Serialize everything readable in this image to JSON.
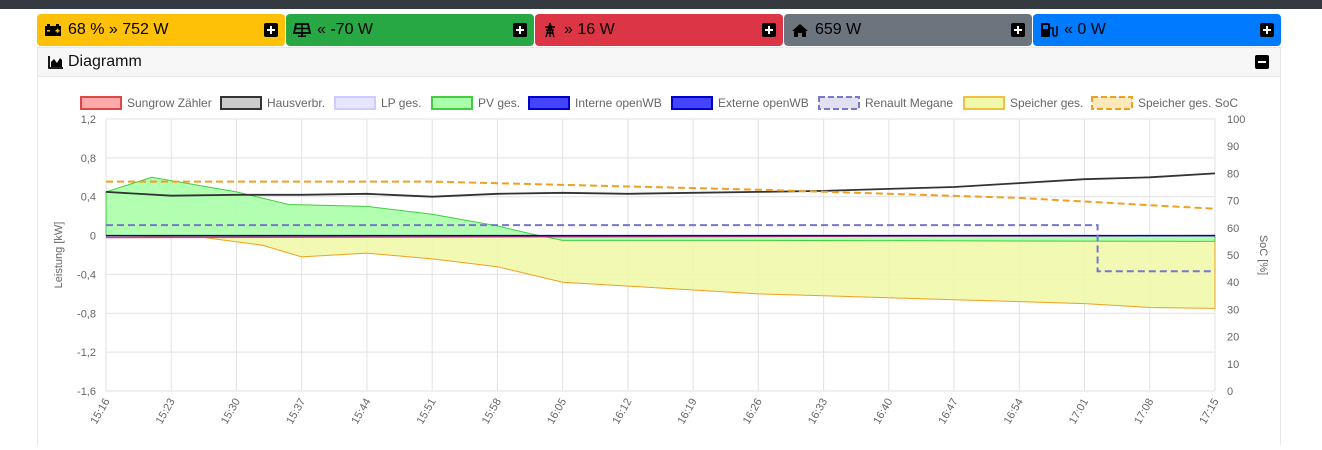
{
  "tiles": [
    {
      "id": "battery",
      "icon": "battery-icon",
      "arrow": "»",
      "text": "68 % » 752 W",
      "bg": "#ffc107",
      "fg": "#000000"
    },
    {
      "id": "pv",
      "icon": "solar-panel-icon",
      "arrow": "«",
      "text": "« -70 W",
      "bg": "#28a745",
      "fg": "#000000"
    },
    {
      "id": "grid",
      "icon": "power-tower-icon",
      "arrow": "»",
      "text": "» 16 W",
      "bg": "#dc3545",
      "fg": "#000000"
    },
    {
      "id": "house",
      "icon": "home-icon",
      "arrow": "",
      "text": "659 W",
      "bg": "#6c757d",
      "fg": "#000000"
    },
    {
      "id": "charge",
      "icon": "charging-station-icon",
      "arrow": "«",
      "text": "« 0 W",
      "bg": "#007bff",
      "fg": "#000000"
    }
  ],
  "card": {
    "title": "Diagramm"
  },
  "chart_data": {
    "type": "line",
    "x": [
      "15:16",
      "15:23",
      "15:30",
      "15:37",
      "15:44",
      "15:51",
      "15:58",
      "16:05",
      "16:12",
      "16:19",
      "16:26",
      "16:33",
      "16:40",
      "16:47",
      "16:54",
      "17:01",
      "17:08",
      "17:15"
    ],
    "ylabel": "Leistung [kW]",
    "y2label": "SoC [%]",
    "ylim": [
      -1.6,
      1.2
    ],
    "y2lim": [
      0,
      100
    ],
    "yticks": [
      "1,2",
      "0,8",
      "0,4",
      "0",
      "-0,4",
      "-0,8",
      "-1,2",
      "-1,6"
    ],
    "y2ticks": [
      "100",
      "90",
      "80",
      "70",
      "60",
      "50",
      "40",
      "30",
      "20",
      "10",
      "0"
    ],
    "grid": true,
    "legend_position": "top",
    "legend": [
      {
        "name": "Sungrow Zähler",
        "fill": "#ffaaaa",
        "stroke": "#e04848",
        "dashed": false
      },
      {
        "name": "Hausverbr.",
        "fill": "#cccccc",
        "stroke": "#333333",
        "dashed": false
      },
      {
        "name": "LP ges.",
        "fill": "#e6e6ff",
        "stroke": "#ccccff",
        "dashed": false
      },
      {
        "name": "PV ges.",
        "fill": "#aaffaa",
        "stroke": "#44cc44",
        "dashed": false
      },
      {
        "name": "Interne openWB",
        "fill": "#4444ff",
        "stroke": "#0000cc",
        "dashed": false
      },
      {
        "name": "Externe openWB",
        "fill": "#4444ff",
        "stroke": "#0000cc",
        "dashed": false
      },
      {
        "name": "Renault Megane",
        "fill": "#e0e0f0",
        "stroke": "#7777cc",
        "dashed": true
      },
      {
        "name": "Speicher ges.",
        "fill": "#f0f8aa",
        "stroke": "#f0c040",
        "dashed": false
      },
      {
        "name": "Speicher ges. SoC",
        "fill": "#fde8bb",
        "stroke": "#f0a020",
        "dashed": true
      }
    ],
    "series": [
      {
        "name": "Hausverbr.",
        "color": "#333333",
        "points": [
          [
            0,
            0.45
          ],
          [
            1,
            0.41
          ],
          [
            2,
            0.42
          ],
          [
            3,
            0.42
          ],
          [
            4,
            0.43
          ],
          [
            5,
            0.4
          ],
          [
            6,
            0.43
          ],
          [
            7,
            0.44
          ],
          [
            8,
            0.43
          ],
          [
            9,
            0.44
          ],
          [
            10,
            0.45
          ],
          [
            11,
            0.46
          ],
          [
            12,
            0.48
          ],
          [
            13,
            0.5
          ],
          [
            14,
            0.54
          ],
          [
            15,
            0.58
          ],
          [
            16,
            0.6
          ],
          [
            17,
            0.64
          ]
        ]
      },
      {
        "name": "PV ges.",
        "color": "#44cc44",
        "points": [
          [
            0,
            0.45
          ],
          [
            0.7,
            0.6
          ],
          [
            2,
            0.45
          ],
          [
            2.8,
            0.32
          ],
          [
            4,
            0.3
          ],
          [
            5,
            0.22
          ],
          [
            6,
            0.1
          ],
          [
            6.5,
            0.02
          ],
          [
            7,
            -0.05
          ],
          [
            10,
            -0.05
          ],
          [
            17,
            -0.06
          ]
        ]
      },
      {
        "name": "Speicher ges.",
        "color": "#f0a020",
        "points": [
          [
            0,
            0
          ],
          [
            1.5,
            -0.02
          ],
          [
            2.4,
            -0.1
          ],
          [
            3,
            -0.22
          ],
          [
            4,
            -0.18
          ],
          [
            5,
            -0.24
          ],
          [
            6,
            -0.32
          ],
          [
            7,
            -0.48
          ],
          [
            8,
            -0.52
          ],
          [
            9,
            -0.56
          ],
          [
            10,
            -0.6
          ],
          [
            11,
            -0.62
          ],
          [
            12,
            -0.64
          ],
          [
            13,
            -0.66
          ],
          [
            14,
            -0.68
          ],
          [
            15,
            -0.7
          ],
          [
            16,
            -0.74
          ],
          [
            17,
            -0.75
          ]
        ]
      },
      {
        "name": "Sungrow Zähler",
        "color": "#e04848",
        "points": [
          [
            0,
            -0.02
          ],
          [
            17,
            0.0
          ]
        ]
      },
      {
        "name": "Renault Megane",
        "color": "#7777cc",
        "soc": true,
        "points": [
          [
            0,
            61
          ],
          [
            15.2,
            61
          ],
          [
            15.2,
            44
          ],
          [
            17,
            44
          ]
        ]
      },
      {
        "name": "Speicher ges. SoC",
        "color": "#f0a020",
        "soc": true,
        "points": [
          [
            0,
            77
          ],
          [
            5,
            77
          ],
          [
            10,
            74
          ],
          [
            14,
            71
          ],
          [
            17,
            67
          ]
        ]
      }
    ]
  }
}
